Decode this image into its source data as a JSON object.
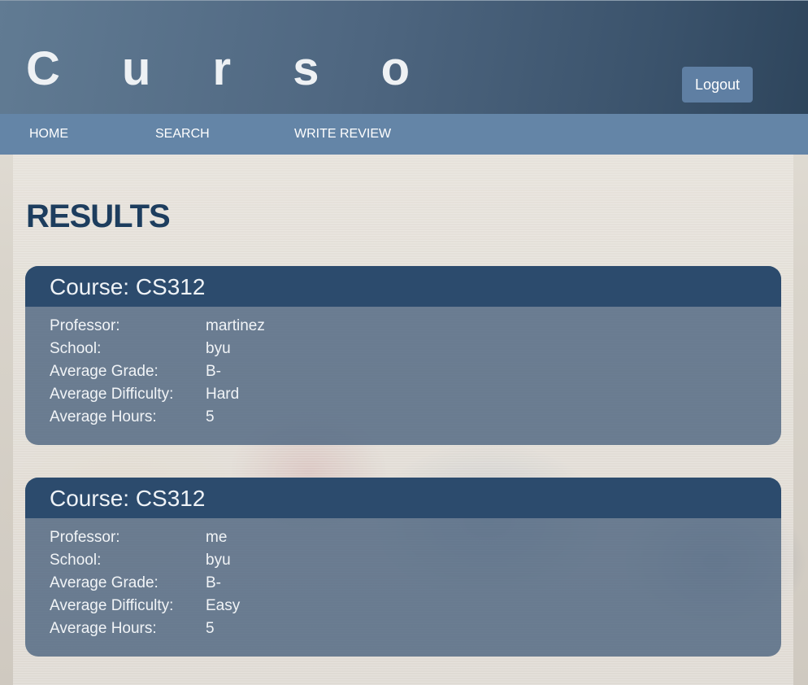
{
  "header": {
    "logo": "C u r s o",
    "logout_label": "Logout"
  },
  "nav": {
    "items": [
      {
        "label": "HOME"
      },
      {
        "label": "SEARCH"
      },
      {
        "label": "WRITE REVIEW"
      }
    ]
  },
  "main": {
    "title": "RESULTS",
    "field_labels": {
      "professor": "Professor:",
      "school": "School:",
      "grade": "Average Grade:",
      "difficulty": "Average Difficulty:",
      "hours": "Average Hours:"
    },
    "results": [
      {
        "course": "Course: CS312",
        "professor": "martinez",
        "school": "byu",
        "grade": "B-",
        "difficulty": "Hard",
        "hours": "5"
      },
      {
        "course": "Course: CS312",
        "professor": "me",
        "school": "byu",
        "grade": "B-",
        "difficulty": "Easy",
        "hours": "5"
      }
    ]
  }
}
